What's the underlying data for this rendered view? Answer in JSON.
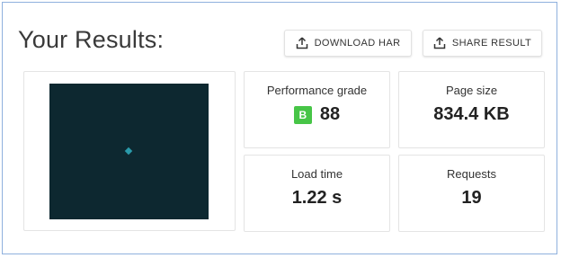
{
  "header": {
    "title": "Your Results:",
    "download_label": "DOWNLOAD HAR",
    "share_label": "SHARE RESULT",
    "download_icon": "upload-tray-icon",
    "share_icon": "upload-tray-icon"
  },
  "metrics": {
    "performance": {
      "label": "Performance grade",
      "grade": "B",
      "value": "88",
      "grade_color": "#47c547"
    },
    "page_size": {
      "label": "Page size",
      "value": "834.4 KB"
    },
    "load_time": {
      "label": "Load time",
      "value": "1.22 s"
    },
    "requests": {
      "label": "Requests",
      "value": "19"
    }
  },
  "screenshot": {
    "background": "#0d2830",
    "accent": "#2a9aaa"
  }
}
